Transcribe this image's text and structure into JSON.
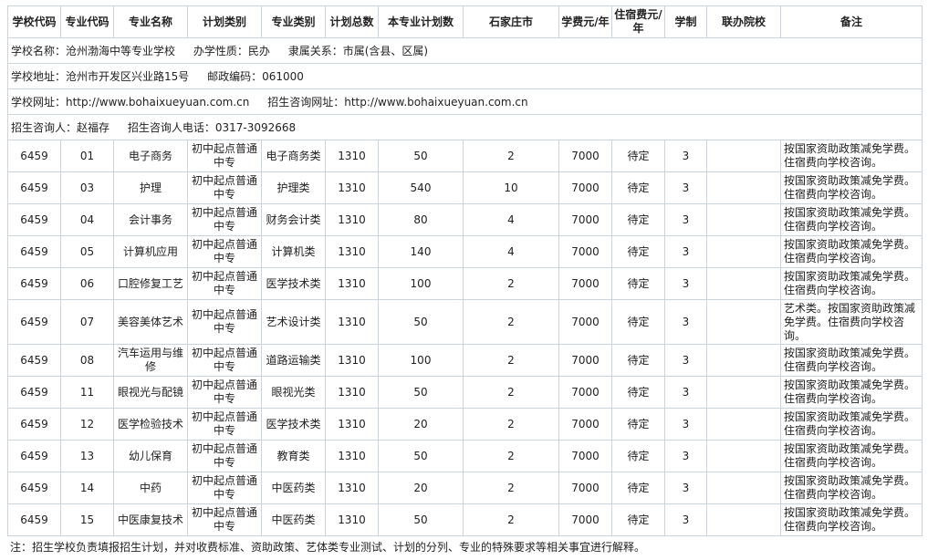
{
  "school": {
    "name_label": "学校名称：沧州渤海中等专业学校",
    "nature_label": "办学性质：民办",
    "affiliation_label": "隶属关系：市属(含县、区属)",
    "address_label": "学校地址：沧州市开发区兴业路15号",
    "postcode_label": "邮政编码：061000",
    "website_label": "学校网址：http://www.bohaixueyuan.com.cn",
    "consult_url_label": "招生咨询网址：http://www.bohaixueyuan.com.cn",
    "contact_label": "招生咨询人：赵福存",
    "phone_label": "招生咨询人电话：0317-3092668"
  },
  "table": {
    "headers": [
      "学校代码",
      "专业代码",
      "专业名称",
      "计划类别",
      "专业类别",
      "计划总数",
      "本专业计划数",
      "石家庄市",
      "学费元/年",
      "住宿费元/年",
      "学制",
      "联办院校",
      "备注"
    ],
    "rows": [
      [
        "6459",
        "01",
        "电子商务",
        "初中起点普通中专",
        "电子商务类",
        "1310",
        "50",
        "2",
        "7000",
        "待定",
        "3",
        "",
        "按国家资助政策减免学费。住宿费向学校咨询。"
      ],
      [
        "6459",
        "03",
        "护理",
        "初中起点普通中专",
        "护理类",
        "1310",
        "540",
        "10",
        "7000",
        "待定",
        "3",
        "",
        "按国家资助政策减免学费。住宿费向学校咨询。"
      ],
      [
        "6459",
        "04",
        "会计事务",
        "初中起点普通中专",
        "财务会计类",
        "1310",
        "80",
        "4",
        "7000",
        "待定",
        "3",
        "",
        "按国家资助政策减免学费。住宿费向学校咨询。"
      ],
      [
        "6459",
        "05",
        "计算机应用",
        "初中起点普通中专",
        "计算机类",
        "1310",
        "140",
        "4",
        "7000",
        "待定",
        "3",
        "",
        "按国家资助政策减免学费。住宿费向学校咨询。"
      ],
      [
        "6459",
        "06",
        "口腔修复工艺",
        "初中起点普通中专",
        "医学技术类",
        "1310",
        "100",
        "2",
        "7000",
        "待定",
        "3",
        "",
        "按国家资助政策减免学费。住宿费向学校咨询。"
      ],
      [
        "6459",
        "07",
        "美容美体艺术",
        "初中起点普通中专",
        "艺术设计类",
        "1310",
        "50",
        "2",
        "7000",
        "待定",
        "3",
        "",
        "艺术类。按国家资助政策减免学费。住宿费向学校咨询。"
      ],
      [
        "6459",
        "08",
        "汽车运用与维修",
        "初中起点普通中专",
        "道路运输类",
        "1310",
        "100",
        "2",
        "7000",
        "待定",
        "3",
        "",
        "按国家资助政策减免学费。住宿费向学校咨询。"
      ],
      [
        "6459",
        "11",
        "眼视光与配镜",
        "初中起点普通中专",
        "眼视光类",
        "1310",
        "50",
        "2",
        "7000",
        "待定",
        "3",
        "",
        "按国家资助政策减免学费。住宿费向学校咨询。"
      ],
      [
        "6459",
        "12",
        "医学检验技术",
        "初中起点普通中专",
        "医学技术类",
        "1310",
        "20",
        "2",
        "7000",
        "待定",
        "3",
        "",
        "按国家资助政策减免学费。住宿费向学校咨询。"
      ],
      [
        "6459",
        "13",
        "幼儿保育",
        "初中起点普通中专",
        "教育类",
        "1310",
        "50",
        "2",
        "7000",
        "待定",
        "3",
        "",
        "按国家资助政策减免学费。住宿费向学校咨询。"
      ],
      [
        "6459",
        "14",
        "中药",
        "初中起点普通中专",
        "中医药类",
        "1310",
        "20",
        "2",
        "7000",
        "待定",
        "3",
        "",
        "按国家资助政策减免学费。住宿费向学校咨询。"
      ],
      [
        "6459",
        "15",
        "中医康复技术",
        "初中起点普通中专",
        "中医药类",
        "1310",
        "50",
        "2",
        "7000",
        "待定",
        "3",
        "",
        "按国家资助政策减免学费。住宿费向学校咨询。"
      ]
    ]
  },
  "footnote": "注：招生学校负责填报招生计划，并对收费标准、资助政策、艺体类专业测试、计划的分列、专业的特殊要求等相关事宜进行解释。"
}
